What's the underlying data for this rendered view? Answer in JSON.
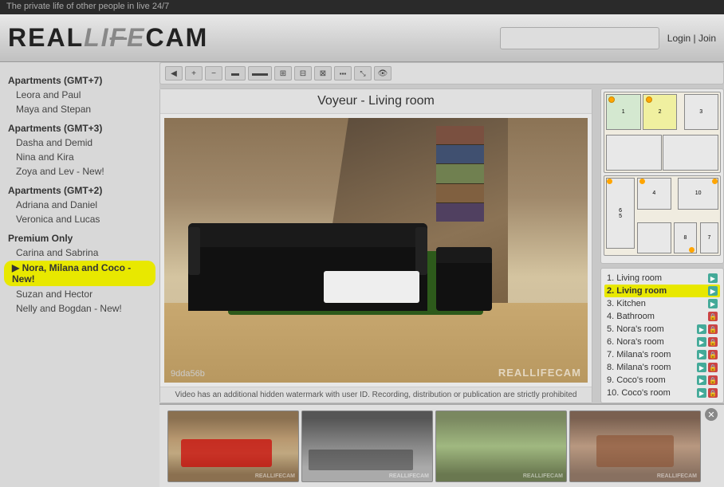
{
  "top_banner": {
    "text": "The private life of other people in live 24/7"
  },
  "header": {
    "logo": "REALLIFECAM",
    "login_label": "Login",
    "join_label": "Join",
    "separator": "|"
  },
  "toolbar": {
    "buttons": [
      {
        "id": "prev",
        "icon": "◀",
        "label": "Previous"
      },
      {
        "id": "plus",
        "icon": "+",
        "label": "Zoom in"
      },
      {
        "id": "minus",
        "icon": "−",
        "label": "Zoom out"
      },
      {
        "id": "layout1",
        "icon": "▬",
        "label": "Layout 1"
      },
      {
        "id": "layout2",
        "icon": "▬▬",
        "label": "Layout 2"
      },
      {
        "id": "layout3",
        "icon": "⊞",
        "label": "Layout 3"
      },
      {
        "id": "layout4",
        "icon": "⊟",
        "label": "Layout 4"
      },
      {
        "id": "layout5",
        "icon": "⊠",
        "label": "Layout 5"
      },
      {
        "id": "layout6",
        "icon": "⊡",
        "label": "Layout 6"
      },
      {
        "id": "layout7",
        "icon": "⤡",
        "label": "Fullscreen"
      },
      {
        "id": "eye",
        "icon": "👁",
        "label": "View"
      }
    ]
  },
  "video": {
    "title": "Voyeur - Living room",
    "id_label": "9dda56b",
    "watermark": "REALLIFECAM",
    "notice": "Video has an additional hidden watermark with user ID. Recording, distribution or publication are strictly prohibited"
  },
  "sidebar": {
    "groups": [
      {
        "title": "Apartments (GMT+7)",
        "items": [
          {
            "label": "Leora and Paul",
            "active": false,
            "new": false
          },
          {
            "label": "Maya and Stepan",
            "active": false,
            "new": false
          }
        ]
      },
      {
        "title": "Apartments (GMT+3)",
        "items": [
          {
            "label": "Dasha and Demid",
            "active": false,
            "new": false
          },
          {
            "label": "Nina and Kira",
            "active": false,
            "new": false
          },
          {
            "label": "Zoya and Lev - New!",
            "active": false,
            "new": true
          }
        ]
      },
      {
        "title": "Apartments (GMT+2)",
        "items": [
          {
            "label": "Adriana and Daniel",
            "active": false,
            "new": false
          },
          {
            "label": "Veronica and Lucas",
            "active": false,
            "new": false
          }
        ]
      },
      {
        "title": "Premium Only",
        "items": [
          {
            "label": "Carina and Sabrina",
            "active": false,
            "new": false
          },
          {
            "label": "Nora, Milana and Coco - New!",
            "active": true,
            "new": true
          },
          {
            "label": "Suzan and Hector",
            "active": false,
            "new": false
          },
          {
            "label": "Nelly and Bogdan - New!",
            "active": false,
            "new": true
          }
        ]
      }
    ]
  },
  "camera_list": {
    "items": [
      {
        "number": 1,
        "label": "Living room",
        "icons": [
          "green"
        ],
        "active": false
      },
      {
        "number": 2,
        "label": "Living room",
        "icons": [
          "green"
        ],
        "active": true
      },
      {
        "number": 3,
        "label": "Kitchen",
        "icons": [
          "green"
        ],
        "active": false
      },
      {
        "number": 4,
        "label": "Bathroom",
        "icons": [
          "lock"
        ],
        "active": false
      },
      {
        "number": 5,
        "label": "Nora's room",
        "icons": [
          "green",
          "red"
        ],
        "active": false
      },
      {
        "number": 6,
        "label": "Nora's room",
        "icons": [
          "green",
          "red"
        ],
        "active": false
      },
      {
        "number": 7,
        "label": "Milana's room",
        "icons": [
          "green",
          "red"
        ],
        "active": false
      },
      {
        "number": 8,
        "label": "Milana's room",
        "icons": [
          "green",
          "red"
        ],
        "active": false
      },
      {
        "number": 9,
        "label": "Coco's room",
        "icons": [
          "green",
          "red"
        ],
        "active": false
      },
      {
        "number": 10,
        "label": "Coco's room",
        "icons": [
          "green",
          "red"
        ],
        "active": false
      }
    ]
  },
  "thumbnails": [
    {
      "scene": 1
    },
    {
      "scene": 2
    },
    {
      "scene": 3
    },
    {
      "scene": 4
    }
  ],
  "colors": {
    "accent_yellow": "#e8e800",
    "active_green": "#4aaa88",
    "lock_red": "#cc4444"
  }
}
